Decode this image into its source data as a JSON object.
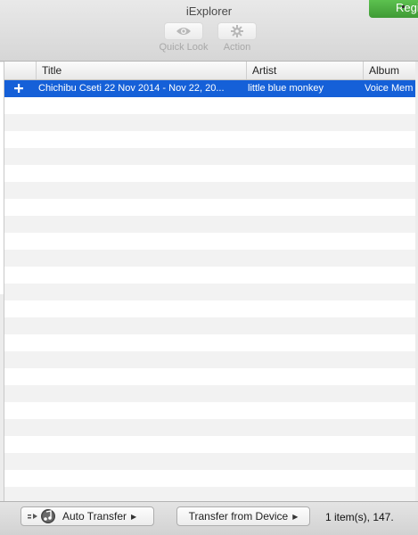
{
  "window": {
    "title": "iExplorer"
  },
  "register_label": "Regi",
  "toolbar": {
    "items": [
      {
        "label": "Quick Look",
        "icon": "eye-icon"
      },
      {
        "label": "Action",
        "icon": "gear-icon"
      }
    ]
  },
  "table": {
    "columns": [
      "",
      "Title",
      "Artist",
      "Album"
    ],
    "rows": [
      {
        "expand_icon": "plus-icon",
        "title": "Chichibu Cseti 22 Nov 2014 - Nov 22, 20...",
        "artist": "little blue monkey",
        "album": "Voice Mem"
      }
    ],
    "selected_color": "#1560d8"
  },
  "footer": {
    "auto_transfer_label": "Auto Transfer",
    "transfer_from_device_label": "Transfer from Device",
    "status": "1 item(s), 147."
  }
}
